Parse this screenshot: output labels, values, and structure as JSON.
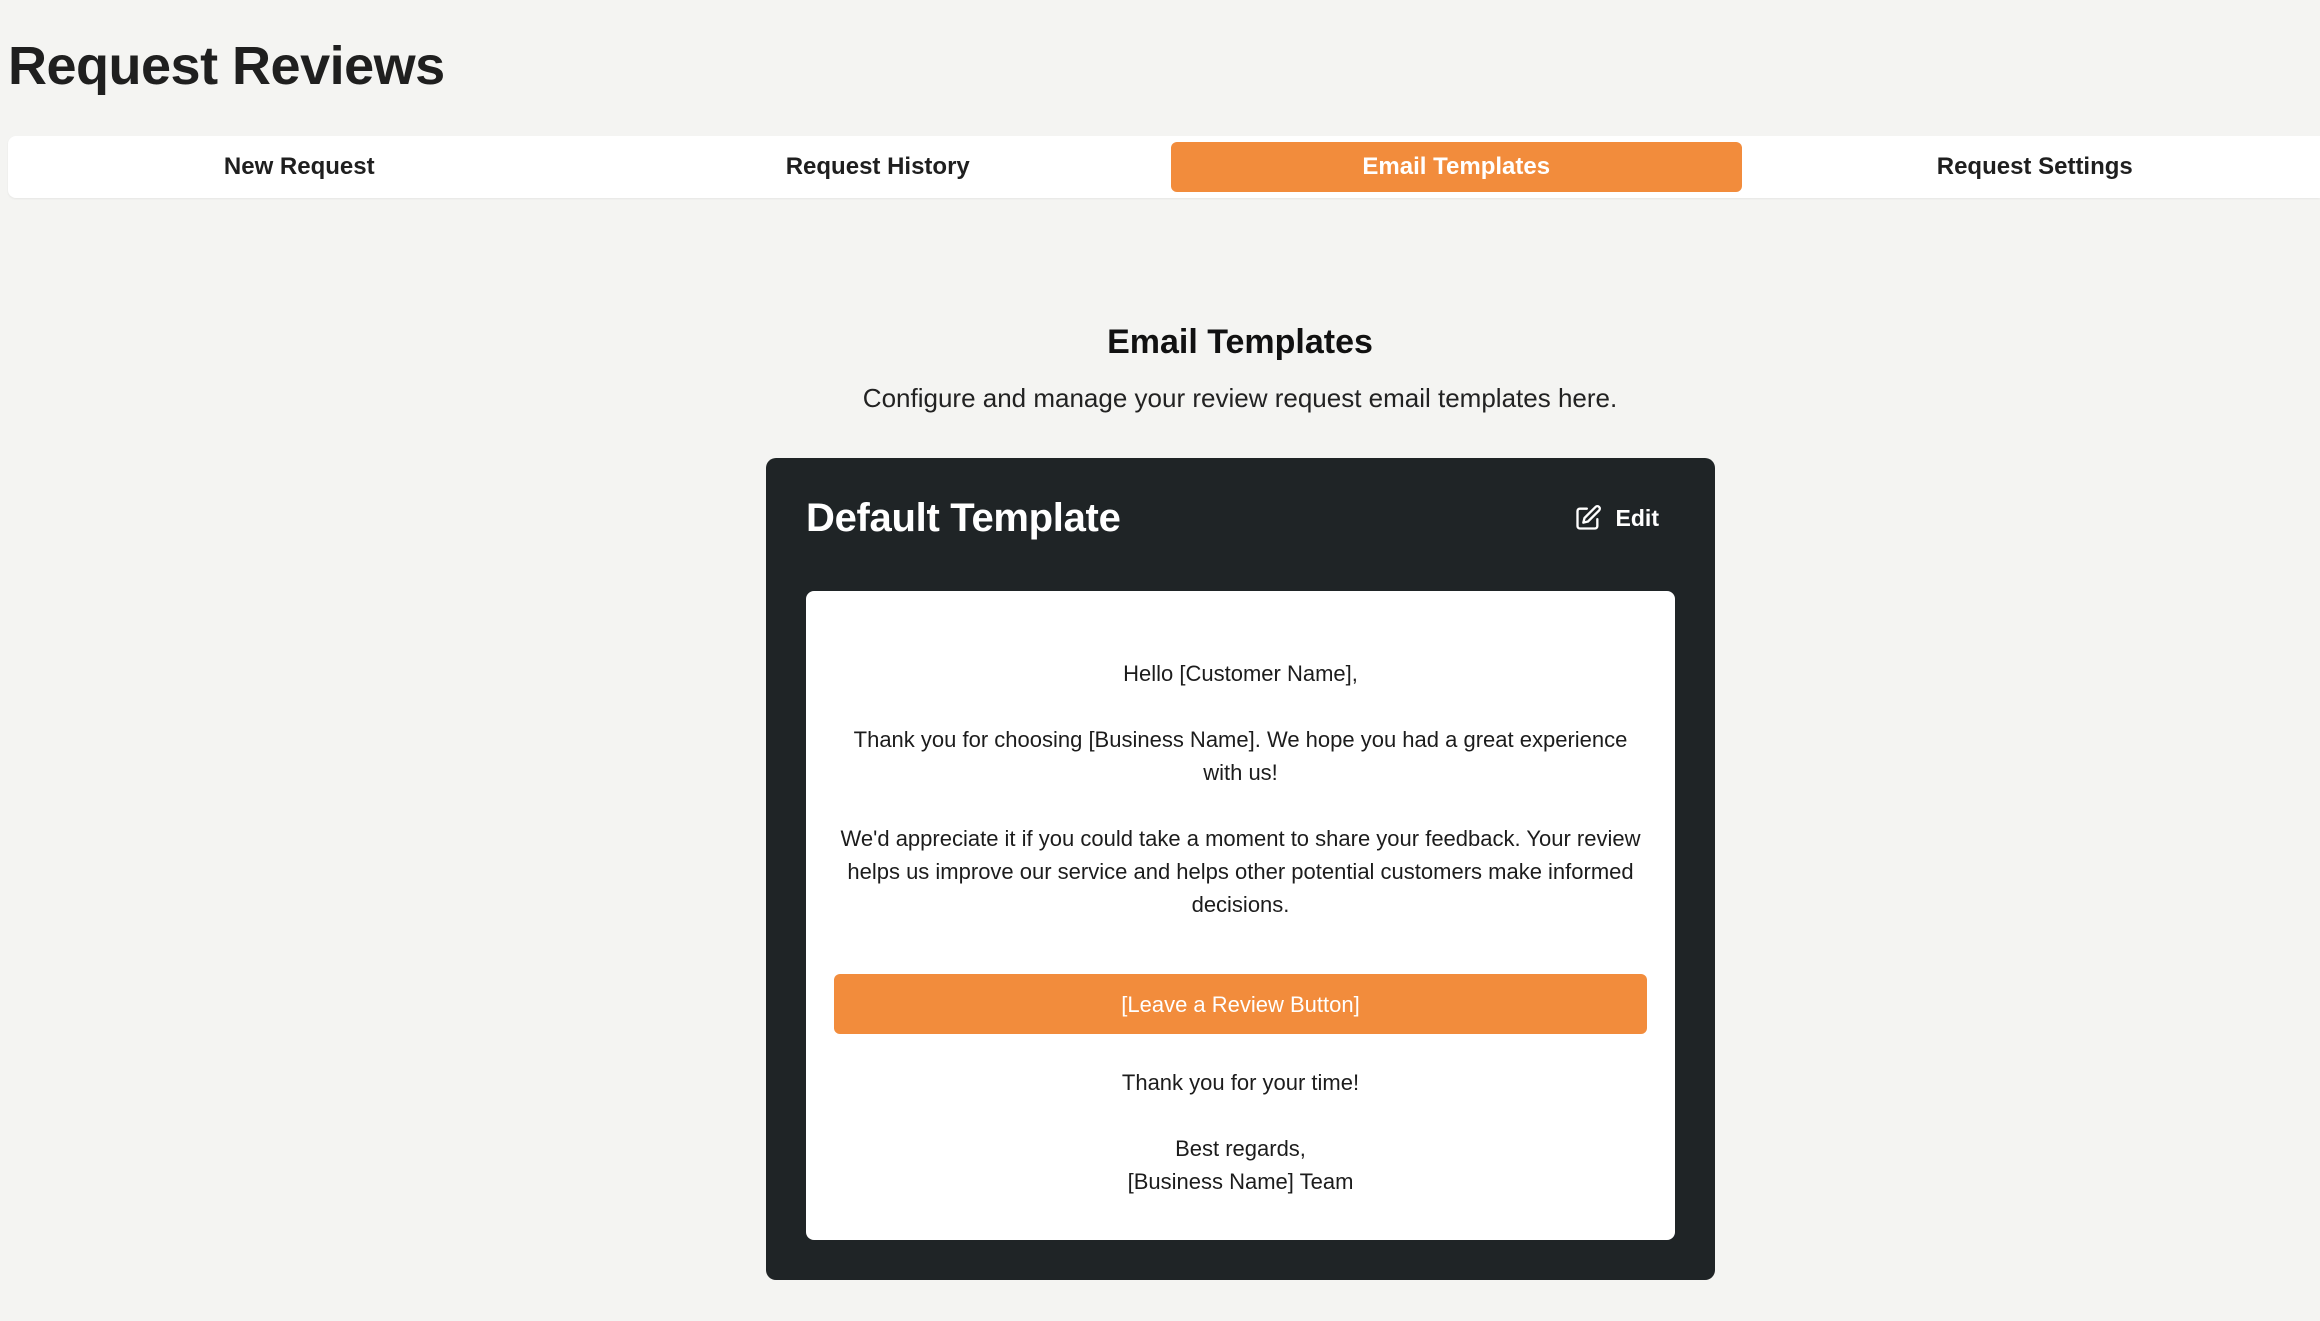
{
  "page": {
    "title": "Request Reviews"
  },
  "tabs": [
    {
      "label": "New Request",
      "active": false
    },
    {
      "label": "Request History",
      "active": false
    },
    {
      "label": "Email Templates",
      "active": true
    },
    {
      "label": "Request Settings",
      "active": false
    }
  ],
  "section": {
    "title": "Email Templates",
    "description": "Configure and manage your review request email templates here."
  },
  "template_card": {
    "title": "Default Template",
    "edit_label": "Edit",
    "edit_icon": "edit-icon",
    "email": {
      "greeting": "Hello [Customer Name],",
      "paragraph_1": "Thank you for choosing [Business Name]. We hope you had a great experience with us!",
      "paragraph_2": "We'd appreciate it if you could take a moment to share your feedback. Your review helps us improve our service and helps other potential customers make informed decisions.",
      "button_label": "[Leave a Review Button]",
      "thanks": "Thank you for your time!",
      "closing": "Best regards,",
      "signature": "[Business Name] Team"
    }
  },
  "colors": {
    "accent": "#f28c3c",
    "card_background": "#1f2426",
    "page_background": "#f4f4f2"
  }
}
